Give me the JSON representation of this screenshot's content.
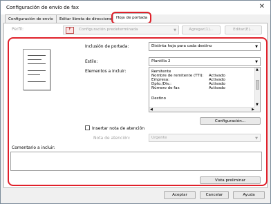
{
  "window": {
    "title": "Configuración de envío de fax",
    "close": "✕"
  },
  "tabs": [
    {
      "label": "Configuración de envío"
    },
    {
      "label": "Editar libreta de direcciones"
    },
    {
      "label": "Hoja de portada"
    }
  ],
  "profile": {
    "label": "Perfil:",
    "value": "Configuración predeterminada",
    "add_button": "Agregar(1)...",
    "edit_button": "Editar(E)..."
  },
  "cover": {
    "inclusion_label": "Inclusión de portada:",
    "inclusion_value": "Distinta hoja para cada destino",
    "style_label": "Estilo:",
    "style_value": "Plantilla 2",
    "elements_label": "Elementos a incluir:",
    "elements": [
      {
        "name": "Remitente",
        "value": ""
      },
      {
        "name": "Nombre de remitente (TTI):",
        "value": "Activado"
      },
      {
        "name": "Empresa:",
        "value": "Activado"
      },
      {
        "name": "Dpto./Div.:",
        "value": "Activado"
      },
      {
        "name": "Número de fax",
        "value": "Activado"
      },
      {
        "name": "",
        "value": ""
      },
      {
        "name": "Destino",
        "value": ""
      }
    ],
    "config_button": "Configuración...",
    "attention_checkbox": "Insertar nota de atención",
    "attention_note_label": "Nota de atención:",
    "attention_note_value": "Urgente",
    "comment_label": "Comentario a incluir:",
    "preview_button": "Vista preliminar"
  },
  "footer": {
    "ok": "Aceptar",
    "cancel": "Cancelar",
    "help": "Ayuda"
  },
  "colors": {
    "highlight": "#e0202a"
  }
}
